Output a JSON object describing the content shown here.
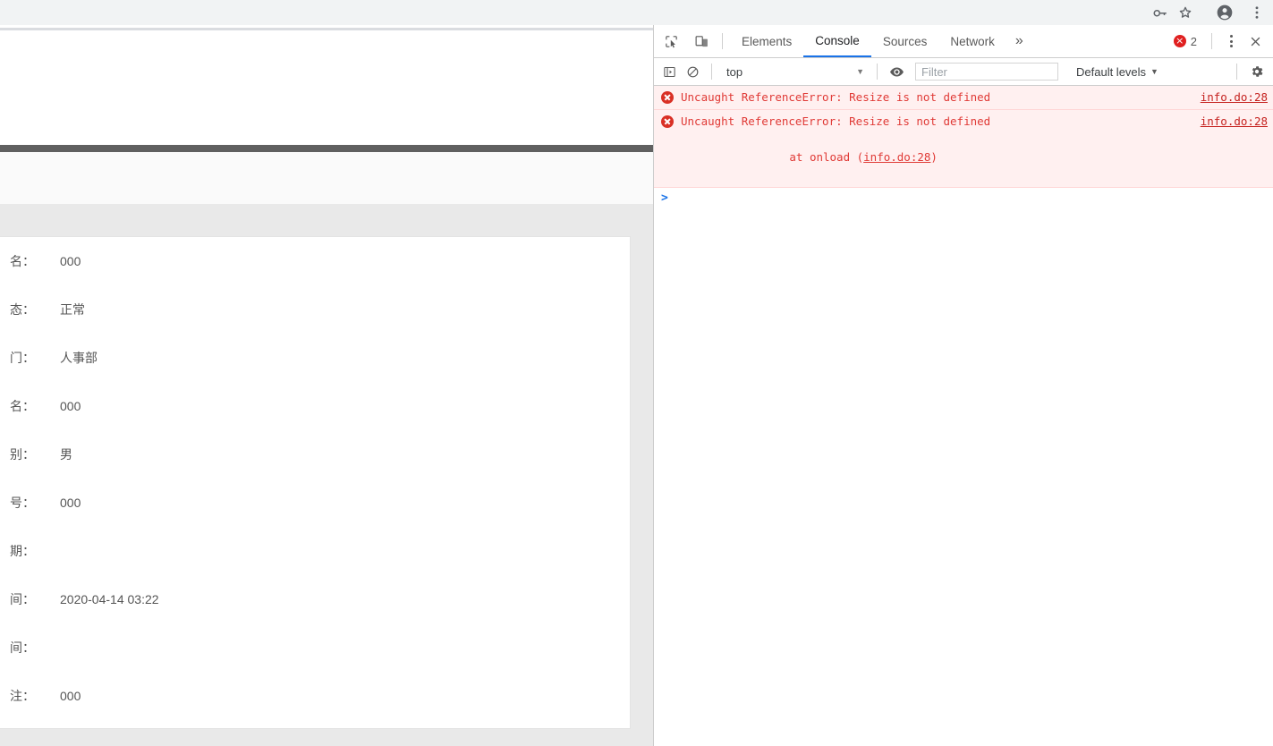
{
  "browser": {
    "toolbar_icons": [
      {
        "name": "password-key-icon",
        "glyph": "key"
      },
      {
        "name": "bookmark-star-icon",
        "glyph": "star"
      },
      {
        "name": "profile-avatar-icon",
        "glyph": "person"
      },
      {
        "name": "chrome-menu-icon",
        "glyph": "kebab"
      }
    ]
  },
  "page": {
    "form_title": "",
    "rows": [
      {
        "label": "名：",
        "value": "000"
      },
      {
        "label": "态：",
        "value": "正常"
      },
      {
        "label": "门：",
        "value": "人事部"
      },
      {
        "label": "名：",
        "value": "000"
      },
      {
        "label": "别：",
        "value": "男"
      },
      {
        "label": "号：",
        "value": "000"
      },
      {
        "label": "期：",
        "value": ""
      },
      {
        "label": "间：",
        "value": "2020-04-14 03:22"
      },
      {
        "label": "间：",
        "value": ""
      },
      {
        "label": "注：",
        "value": "000"
      }
    ]
  },
  "devtools": {
    "inspect_icon": "inspect-element-icon",
    "device_icon": "device-toolbar-icon",
    "tabs": [
      {
        "label": "Elements",
        "active": false
      },
      {
        "label": "Console",
        "active": true
      },
      {
        "label": "Sources",
        "active": false
      },
      {
        "label": "Network",
        "active": false
      }
    ],
    "more_tabs_glyph": "»",
    "error_count": "2",
    "toolbar": {
      "sidebar_toggle_icon": "console-sidebar-icon",
      "clear_console_icon": "clear-console-icon",
      "context_value": "top",
      "eye_icon": "live-expression-icon",
      "filter_placeholder": "Filter",
      "filter_value": "",
      "levels_label": "Default levels",
      "settings_icon": "settings-gear-icon"
    },
    "messages": [
      {
        "text": "Uncaught ReferenceError: Resize is not defined",
        "source": "info.do:28",
        "stack": ""
      },
      {
        "text": "Uncaught ReferenceError: Resize is not defined",
        "source": "info.do:28",
        "stack_prefix": "    at onload (",
        "stack_link": "info.do:28",
        "stack_suffix": ")"
      }
    ],
    "prompt_glyph": ">"
  },
  "colors": {
    "error_red": "#e03a36",
    "error_bg": "#fff0f0",
    "accent_blue": "#1a73e8",
    "badge_red": "#d93025"
  }
}
